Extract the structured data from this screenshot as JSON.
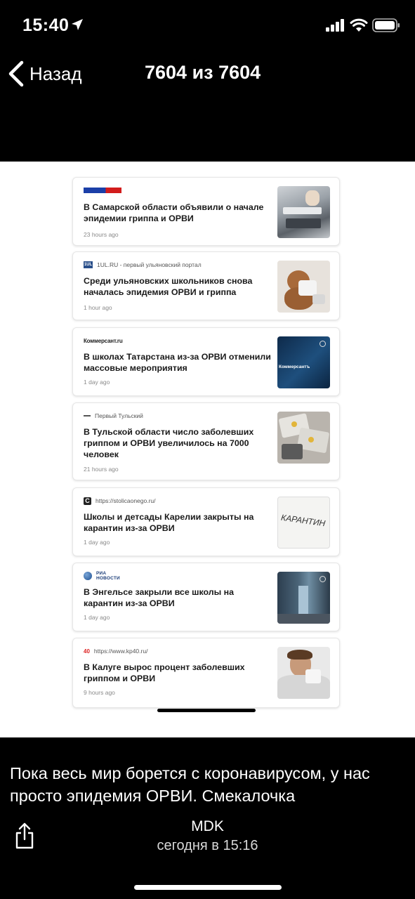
{
  "status": {
    "time": "15:40"
  },
  "nav": {
    "back_label": "Назад",
    "title": "7604 из 7604"
  },
  "news": [
    {
      "source": "",
      "logo": "rossiya-samara-logo",
      "title": "В Самарской области объявили о начале эпидемии гриппа и ОРВИ",
      "time": "23 hours ago"
    },
    {
      "source": "1UL.RU - первый ульяновский портал",
      "logo": "1ul-logo",
      "title": "Среди ульяновских школьников снова началась эпидемия ОРВИ и гриппа",
      "time": "1 hour ago"
    },
    {
      "source": "Коммерсант.ru",
      "logo": "kommersant-logo",
      "title": "В школах Татарстана из-за ОРВИ отменили массовые мероприятия",
      "time": "1 day ago",
      "thumb_text": "Коммерсантъ"
    },
    {
      "source": "Первый Тульский",
      "logo": "pervy-tulsky-logo",
      "title": "В Тульской области число заболевших гриппом и ОРВИ увеличилось на 7000 человек",
      "time": "21 hours ago"
    },
    {
      "source": "https://stolicaonego.ru/",
      "logo": "stolica-onego-logo",
      "title": "Школы и детсады Карелии закрыты на карантин из-за ОРВИ",
      "time": "1 day ago",
      "thumb_text": "КАРАНТИН"
    },
    {
      "source": "РИА НОВОСТИ",
      "logo": "ria-novosti-logo",
      "title": "В Энгельсе закрыли все школы на карантин из-за ОРВИ",
      "time": "1 day ago"
    },
    {
      "source": "https://www.kp40.ru/",
      "logo": "kp40-logo",
      "logo_text": "40",
      "title": "В Калуге вырос процент заболевших гриппом и ОРВИ",
      "time": "9 hours ago"
    }
  ],
  "caption": "Пока весь мир борется с коронавирусом, у нас просто эпидемия ОРВИ. Смекалочка",
  "post": {
    "author": "MDK",
    "date": "сегодня в 15:16"
  },
  "colors": {
    "background": "#000000",
    "photo_bg": "#ffffff",
    "card_title": "#1a1a1a",
    "card_meta": "#8a8a8a"
  }
}
